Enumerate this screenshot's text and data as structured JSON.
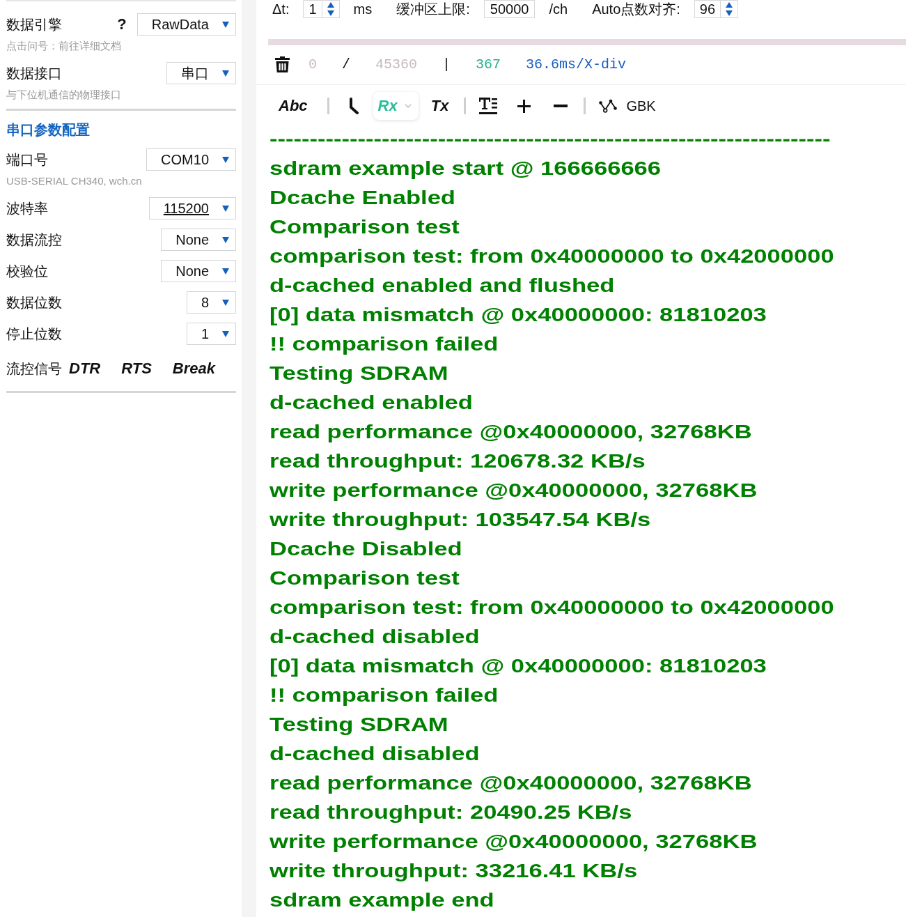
{
  "sidebar": {
    "fields": [
      {
        "label": "数据引擎",
        "help": "?",
        "value": "RawData",
        "hint": "点击问号：前往详细文档",
        "underlined": false
      },
      {
        "label": "数据接口",
        "value": "串口",
        "hint": "与下位机通信的物理接口",
        "underlined": false
      }
    ],
    "section_title": "串口参数配置",
    "serial_fields": [
      {
        "label": "端口号",
        "value": "COM10",
        "hint": "USB-SERIAL CH340, wch.cn",
        "underlined": false
      },
      {
        "label": "波特率",
        "value": "115200",
        "underlined": true
      },
      {
        "label": "数据流控",
        "value": "None",
        "underlined": false
      },
      {
        "label": "校验位",
        "value": "None",
        "underlined": false
      },
      {
        "label": "数据位数",
        "value": "8",
        "underlined": false
      },
      {
        "label": "停止位数",
        "value": "1",
        "underlined": false
      }
    ],
    "flow_signals": {
      "label": "流控信号",
      "buttons": [
        "DTR",
        "RTS",
        "Break"
      ]
    }
  },
  "top_bar": [
    {
      "kind": "label",
      "text": "Δt:"
    },
    {
      "kind": "spinner",
      "value": "1"
    },
    {
      "kind": "unit",
      "text": "ms"
    },
    {
      "kind": "label",
      "text": "缓冲区上限:"
    },
    {
      "kind": "input",
      "value": "50000"
    },
    {
      "kind": "unit",
      "text": "/ch"
    },
    {
      "kind": "label",
      "text": "Auto点数对齐:"
    },
    {
      "kind": "spinner",
      "value": "96"
    }
  ],
  "stats": [
    {
      "kind": "position",
      "text": "0"
    },
    {
      "kind": "separator",
      "text": "/"
    },
    {
      "kind": "total",
      "text": "45360"
    },
    {
      "kind": "separator",
      "text": "|"
    },
    {
      "kind": "count",
      "text": "367"
    },
    {
      "kind": "scale",
      "text": "36.6ms/X-div"
    }
  ],
  "toolbar": {
    "abc": "Abc",
    "rx": {
      "label": "Rx",
      "selected": true
    },
    "tx": {
      "label": "Tx",
      "selected": false
    },
    "encoding": "GBK"
  },
  "log": {
    "lines": [
      "----------------------------------------------------------------------",
      "sdram example start @ 166666666",
      "Dcache Enabled",
      "Comparison test",
      "comparison test: from 0x40000000 to 0x42000000",
      "d-cached enabled and flushed",
      "[0] data mismatch @ 0x40000000: 81810203",
      "!! comparison failed",
      "Testing SDRAM",
      "d-cached enabled",
      "read performance @0x40000000, 32768KB",
      "read throughput: 120678.32 KB/s",
      "write performance @0x40000000, 32768KB",
      "write throughput: 103547.54 KB/s",
      "Dcache Disabled",
      "Comparison test",
      "comparison test: from 0x40000000 to 0x42000000",
      "d-cached disabled",
      "[0] data mismatch @ 0x40000000: 81810203",
      "!! comparison failed",
      "Testing SDRAM",
      "d-cached disabled",
      "read performance @0x40000000, 32768KB",
      "read throughput: 20490.25 KB/s",
      "write performance @0x40000000, 32768KB",
      "write throughput: 33216.41 KB/s",
      "sdram example end"
    ]
  }
}
